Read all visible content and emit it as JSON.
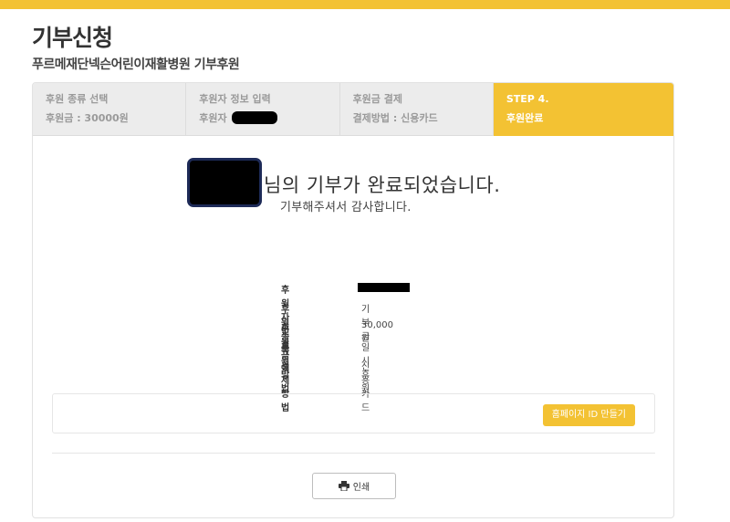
{
  "header": {
    "title": "기부신청",
    "subtitle": "푸르메재단넥슨어린이재활병원 기부후원"
  },
  "steps": [
    {
      "title": "후원 종류 선택",
      "desc": "후원금 : 30000원"
    },
    {
      "title": "후원자 정보 입력",
      "desc": "후원자 "
    },
    {
      "title": "후원금 결제",
      "desc": "결제방법 : 신용카드"
    },
    {
      "title": "STEP 4.",
      "desc": "후원완료"
    }
  ],
  "message": {
    "main": "님의 기부가 완료되었습니다.",
    "sub": "기부해주셔서 감사합니다."
  },
  "info": {
    "rows": [
      {
        "label": "후원자번호",
        "value": ""
      },
      {
        "label": "후원종류",
        "value": "기부금"
      },
      {
        "label": "후원금액",
        "value": "30,000원"
      },
      {
        "label": "후원방법",
        "value": "일시후원"
      },
      {
        "label": "결제방법",
        "value": "신용카드"
      }
    ]
  },
  "actions": {
    "homepage_button": "홈페이지 ID 만들기",
    "print_button": "인쇄"
  },
  "colors": {
    "accent": "#f3c233",
    "step_inactive_bg": "#ececec",
    "redaction": "#000000"
  }
}
